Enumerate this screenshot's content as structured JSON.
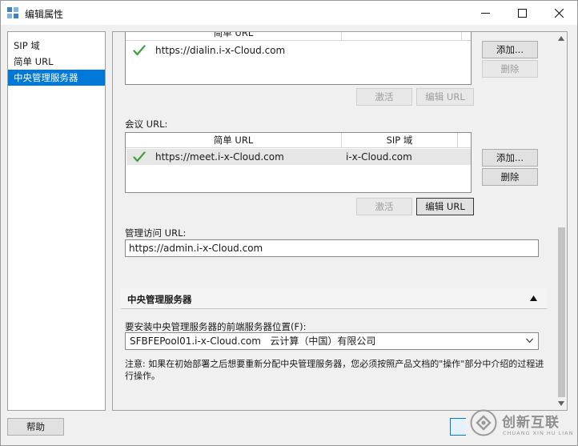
{
  "window": {
    "title": "编辑属性",
    "icon": "properties-icon"
  },
  "nav": {
    "items": [
      {
        "label": "SIP 域",
        "selected": false
      },
      {
        "label": "简单 URL",
        "selected": false
      },
      {
        "label": "中央管理服务器",
        "selected": true
      }
    ]
  },
  "dialin": {
    "header_col1": "简单 URL",
    "rows": [
      {
        "url": "https://dialin.i-x-Cloud.com",
        "active": true
      }
    ],
    "add_label": "添加...",
    "delete_label": "删除",
    "activate_label": "激活",
    "edit_label": "编辑 URL"
  },
  "meeting": {
    "label": "会议 URL:",
    "header_col1": "简单 URL",
    "header_col2": "SIP 域",
    "rows": [
      {
        "url": "https://meet.i-x-Cloud.com",
        "sip": "i-x-Cloud.com",
        "active": true
      }
    ],
    "add_label": "添加...",
    "delete_label": "删除",
    "activate_label": "激活",
    "edit_label": "编辑 URL"
  },
  "admin": {
    "label": "管理访问 URL:",
    "value": "https://admin.i-x-Cloud.com"
  },
  "cms": {
    "section_title": "中央管理服务器",
    "location_label": "要安装中央管理服务器的前端服务器位置(F):",
    "location_value": "SFBFEPool01.i-x-Cloud.com   云计算（中国）有限公司",
    "note": "注意: 如果在初始部署之后想要重新分配中央管理服务器，您必须按照产品文档的\"操作\"部分中介绍的过程进行操作。"
  },
  "footer": {
    "help_label": "帮助"
  },
  "watermark": {
    "cn": "创新互联",
    "en": "CHUANG XIN HU LIAN"
  },
  "colors": {
    "selection": "#0078d7",
    "check": "#3ea23a"
  }
}
